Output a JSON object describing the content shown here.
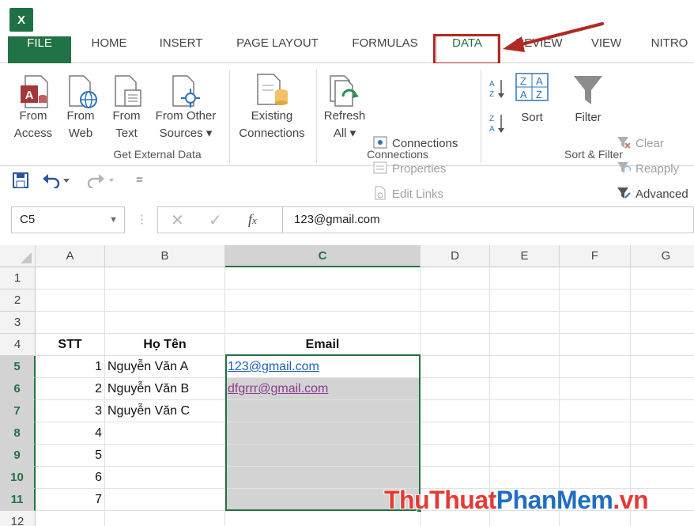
{
  "app": {
    "logo_glyph": "X",
    "accent": "#217346",
    "annotation_color": "#b02a22"
  },
  "tabs": [
    {
      "label": "FILE"
    },
    {
      "label": "HOME"
    },
    {
      "label": "INSERT"
    },
    {
      "label": "PAGE LAYOUT"
    },
    {
      "label": "FORMULAS"
    },
    {
      "label": "DATA"
    },
    {
      "label": "REVIEW"
    },
    {
      "label": "VIEW"
    },
    {
      "label": "NITRO"
    }
  ],
  "ribbon": {
    "get_external": {
      "group_label": "Get External Data",
      "from_access": [
        "From",
        "Access"
      ],
      "from_web": [
        "From",
        "Web"
      ],
      "from_text": [
        "From",
        "Text"
      ],
      "from_other": [
        "From Other",
        "Sources ▾"
      ],
      "existing": [
        "Existing",
        "Connections"
      ]
    },
    "connections": {
      "group_label": "Connections",
      "refresh": [
        "Refresh",
        "All ▾"
      ],
      "connections": "Connections",
      "properties": "Properties",
      "edit_links": "Edit Links"
    },
    "sort_filter": {
      "group_label": "Sort & Filter",
      "sort": "Sort",
      "filter": "Filter",
      "clear": "Clear",
      "reapply": "Reapply",
      "advanced": "Advanced"
    }
  },
  "qat": {
    "customize": "="
  },
  "formula_bar": {
    "name_box": "C5",
    "formula": "123@gmail.com"
  },
  "columns": [
    "A",
    "B",
    "C",
    "D",
    "E",
    "F",
    "G"
  ],
  "rows": [
    "1",
    "2",
    "3",
    "4",
    "5",
    "6",
    "7",
    "8",
    "9",
    "10",
    "11",
    "12"
  ],
  "sheet": {
    "header": {
      "stt": "STT",
      "name": "Họ Tên",
      "email": "Email"
    },
    "data": [
      {
        "stt": "1",
        "name": "Nguyễn Văn A",
        "email": "123@gmail.com"
      },
      {
        "stt": "2",
        "name": "Nguyễn Văn B",
        "email": "dfgrrr@gmail.com"
      },
      {
        "stt": "3",
        "name": "Nguyễn Văn C",
        "email": ""
      },
      {
        "stt": "4",
        "name": "",
        "email": ""
      },
      {
        "stt": "5",
        "name": "",
        "email": ""
      },
      {
        "stt": "6",
        "name": "",
        "email": ""
      },
      {
        "stt": "7",
        "name": "",
        "email": ""
      }
    ]
  },
  "watermark": {
    "part1": "ThuThuat",
    "part2": "PhanMem",
    "part3": ".vn"
  }
}
